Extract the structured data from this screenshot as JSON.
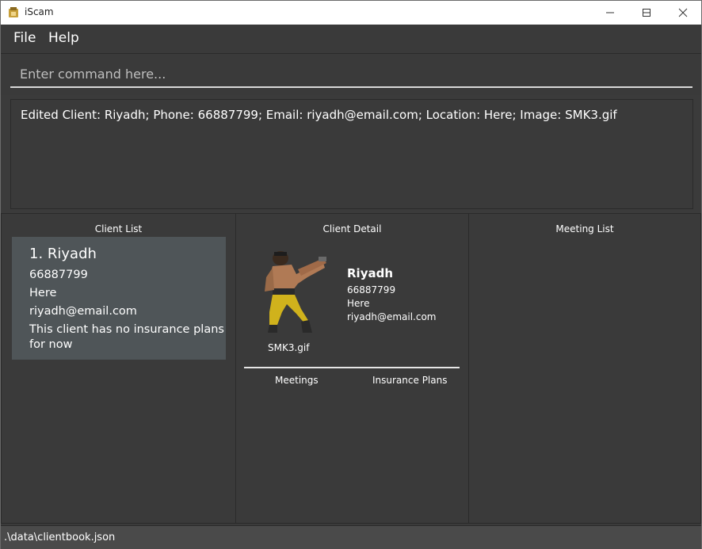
{
  "window": {
    "title": "iScam",
    "accent": "#3a3a3a"
  },
  "menu": {
    "file": "File",
    "help": "Help"
  },
  "command": {
    "placeholder": "Enter command here...",
    "value": ""
  },
  "result": {
    "text": "Edited Client: Riyadh; Phone: 66887799; Email: riyadh@email.com; Location: Here; Image: SMK3.gif"
  },
  "client_list": {
    "title": "Client List",
    "items": [
      {
        "index_name": "1.  Riyadh",
        "phone": "66887799",
        "location": "Here",
        "email": "riyadh@email.com",
        "plans_line1": "This client has no insurance plans",
        "plans_line2": "for now"
      }
    ]
  },
  "client_detail": {
    "title": "Client Detail",
    "name": "Riyadh",
    "phone": "66887799",
    "location": "Here",
    "email": "riyadh@email.com",
    "image_name": "SMK3.gif",
    "tab_meetings": "Meetings",
    "tab_plans": "Insurance Plans"
  },
  "meeting_list": {
    "title": "Meeting List"
  },
  "status": {
    "path": ".\\data\\clientbook.json"
  }
}
